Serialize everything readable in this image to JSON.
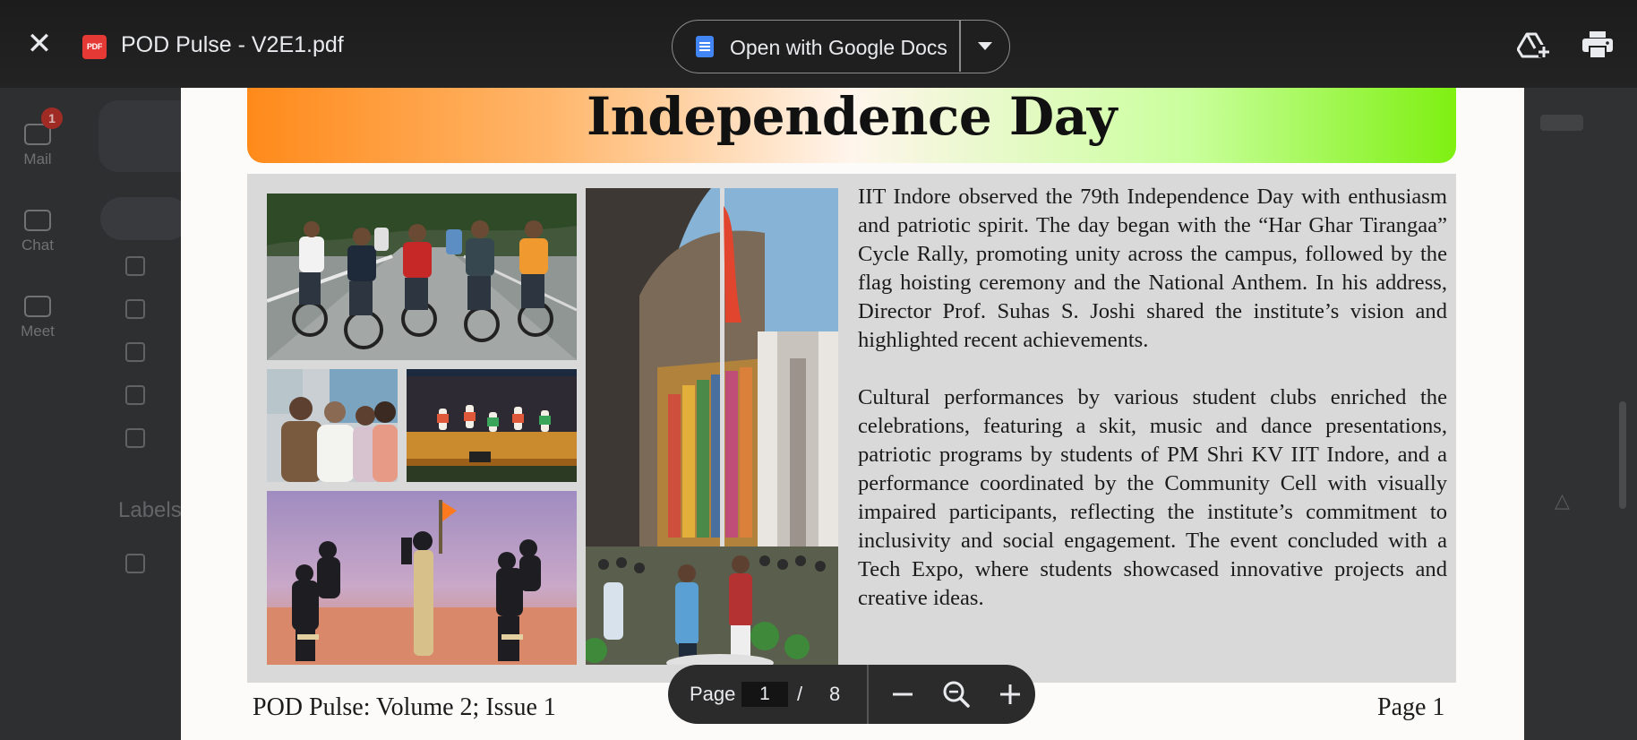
{
  "viewer": {
    "file_title": "POD Pulse - V2E1.pdf",
    "file_badge": "PDF",
    "open_with_label": "Open with Google Docs"
  },
  "backdrop": {
    "mail_label": "Mail",
    "chat_label": "Chat",
    "meet_label": "Meet",
    "mail_badge": "1",
    "labels_heading": "Labels"
  },
  "pdf": {
    "title": "Independence Day",
    "paragraphs": [
      "IIT Indore observed the 79th Independence Day with enthusiasm and patriotic spirit. The day began with the “Har Ghar Tirangaa” Cycle Rally, promoting unity across the campus, followed by the flag hoisting ceremony and the National Anthem. In his address, Director Prof. Suhas S. Joshi shared the institute’s vision and highlighted recent achievements.",
      "Cultural performances by various student clubs enriched the celebrations, featuring a skit, music and dance presentations, patriotic programs by students of PM Shri KV IIT Indore, and a performance coordinated by the Community Cell with visually impaired participants, reflecting the institute’s commitment to inclusivity and social engagement. The event concluded with a Tech Expo, where students showcased innovative projects and creative ideas."
    ],
    "footer_left": "POD Pulse: Volume 2; Issue 1",
    "footer_right": "Page 1"
  },
  "page_controls": {
    "page_label": "Page",
    "current_page": "1",
    "separator": "/",
    "total_pages": "8"
  },
  "colors": {
    "banner_left": "#ff8a1a",
    "banner_right": "#7ef011",
    "toolbar_bg": "#1c1c1c",
    "pdf_icon": "#e53935",
    "docs_icon": "#4285f4"
  }
}
